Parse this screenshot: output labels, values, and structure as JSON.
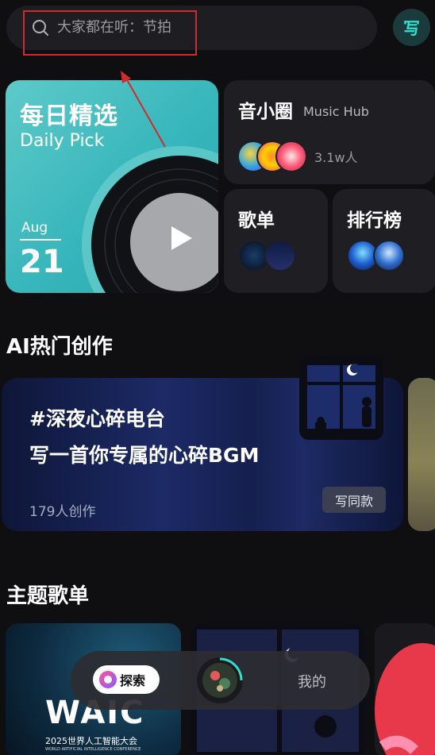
{
  "search": {
    "placeholder": "大家都在听：节拍"
  },
  "header": {
    "write_label": "写"
  },
  "daily_pick": {
    "title": "每日精选",
    "subtitle": "Daily Pick",
    "month": "Aug",
    "day": "21"
  },
  "music_hub": {
    "title": "音小圈",
    "subtitle": "Music Hub",
    "count": "3.1w人"
  },
  "songs": {
    "title": "歌单"
  },
  "ranking": {
    "title": "排行榜"
  },
  "ai_section": {
    "title": "AI热门创作",
    "card": {
      "tag": "#深夜心碎电台",
      "desc": "写一首你专属的心碎BGM",
      "count": "179人创作",
      "button": "写同款"
    }
  },
  "theme_section": {
    "title": "主题歌单",
    "waic": {
      "logo": "WAIC",
      "line1": "2025世界人工智能大会",
      "line2": "WORLD ARTIFICIAL INTELLIGENCE CONFERENCE"
    }
  },
  "bottom_nav": {
    "explore": "探索",
    "mine": "我的"
  },
  "colors": {
    "accent": "#2fe0d1",
    "highlight": "#d32b2b",
    "daily_card": "#36b6bb",
    "card_bg": "#1f1f23"
  },
  "icons": [
    "search-icon",
    "write-icon",
    "play-icon",
    "explore-icon"
  ]
}
